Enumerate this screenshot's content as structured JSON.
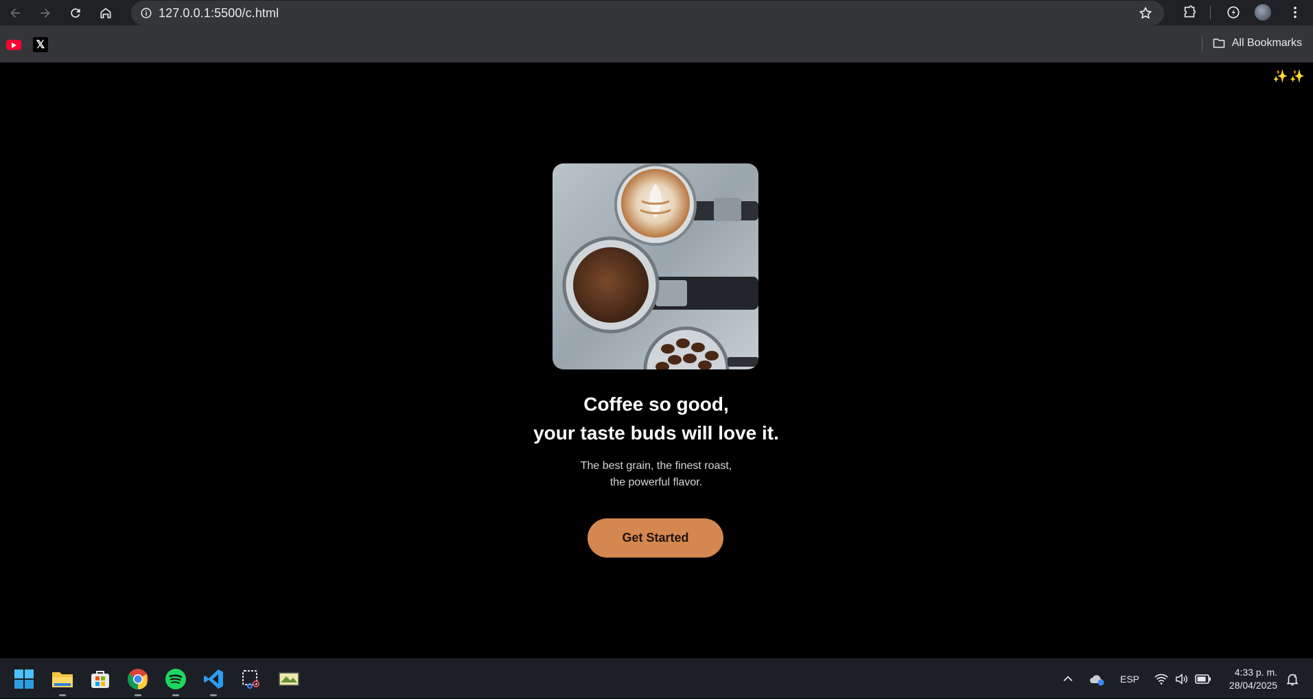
{
  "browser": {
    "url": "127.0.0.1:5500/c.html",
    "bookmarks": [
      {
        "name": "youtube-icon"
      },
      {
        "name": "x-icon",
        "glyph": "𝕏"
      }
    ],
    "all_bookmarks_label": "All Bookmarks"
  },
  "page": {
    "sparkles": "✨✨",
    "headline_line1": "Coffee so good,",
    "headline_line2": "your taste buds will love it.",
    "sub_line1": "The best grain, the finest roast,",
    "sub_line2": "the powerful flavor.",
    "cta_label": "Get Started",
    "accent_color": "#d4874f"
  },
  "taskbar": {
    "apps": [
      "start-icon",
      "file-explorer-icon",
      "microsoft-store-icon",
      "chrome-icon",
      "spotify-icon",
      "vscode-icon",
      "snipping-tool-icon",
      "photo-app-icon"
    ],
    "language": "ESP",
    "time": "4:33 p. m.",
    "date": "28/04/2025"
  }
}
